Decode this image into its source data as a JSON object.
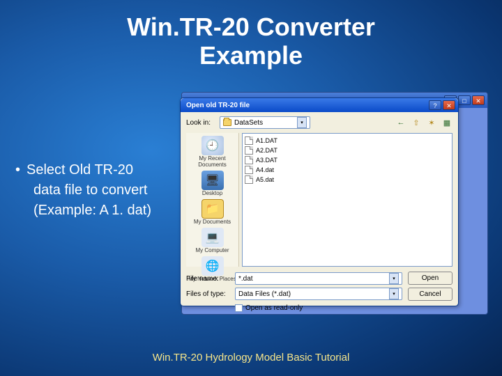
{
  "slide": {
    "title_line1": "Win.TR-20 Converter",
    "title_line2": "Example",
    "bullet_lead": "Select Old TR-20",
    "bullet_l2": "data file to convert",
    "bullet_l3": "(Example:  A 1. dat)",
    "footer": "Win.TR-20 Hydrology Model Basic Tutorial"
  },
  "dialog": {
    "title": "Open old TR-20 file",
    "lookin_label": "Look in:",
    "lookin_value": "DataSets",
    "toolbar": {
      "back": "←",
      "up": "⇧",
      "newfolder": "✶",
      "views": "▦"
    },
    "places": {
      "recent": "My Recent Documents",
      "desktop": "Desktop",
      "mydocs": "My Documents",
      "mycomputer": "My Computer",
      "network": "My Network Places"
    },
    "files": [
      "A1.DAT",
      "A2.DAT",
      "A3.DAT",
      "A4.dat",
      "A5.dat"
    ],
    "filename_label": "File name:",
    "filename_value": "*.dat",
    "filetype_label": "Files of type:",
    "filetype_value": "Data Files (*.dat)",
    "readonly_label": "Open as read-only",
    "open_btn": "Open",
    "cancel_btn": "Cancel",
    "help": "?",
    "close": "✕",
    "min": "_",
    "max": "□"
  }
}
